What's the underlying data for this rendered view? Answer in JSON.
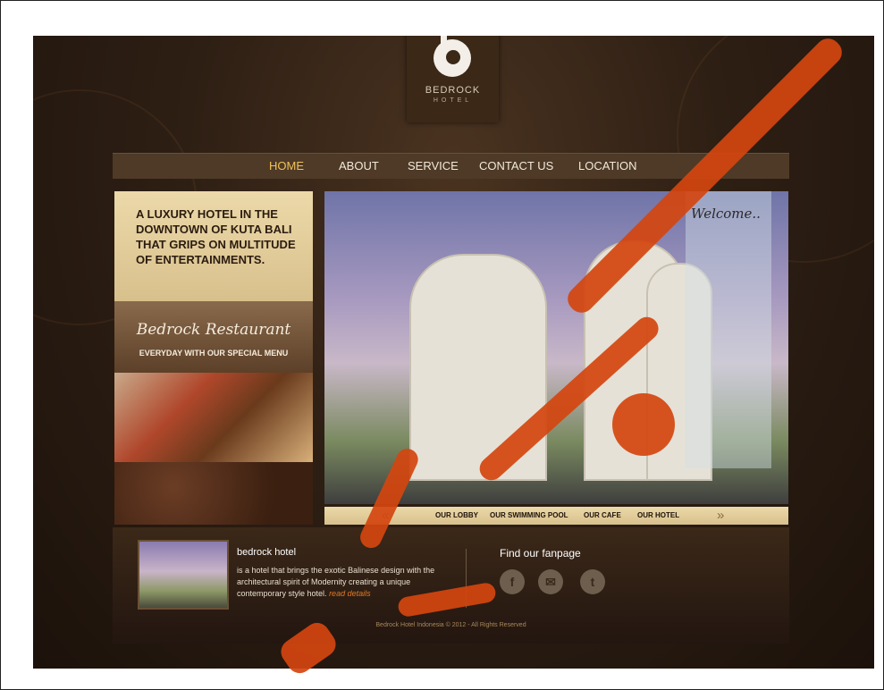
{
  "logo": {
    "name": "BEDROCK",
    "sub": "HOTEL"
  },
  "nav": {
    "items": [
      {
        "label": "HOME",
        "active": true
      },
      {
        "label": "ABOUT",
        "active": false
      },
      {
        "label": "SERVICE",
        "active": false
      },
      {
        "label": "CONTACT US",
        "active": false
      },
      {
        "label": "LOCATION",
        "active": false
      }
    ]
  },
  "tagline": "A LUXURY HOTEL IN THE DOWNTOWN OF KUTA BALI THAT GRIPS ON MULTITUDE OF ENTERTAINMENTS.",
  "restaurant": {
    "title": "Bedrock Restaurant",
    "subtitle": "EVERYDAY WITH OUR SPECIAL MENU"
  },
  "slider": {
    "welcome": "Welcome..",
    "prev": "«",
    "next": "»",
    "links": [
      "OUR LOBBY",
      "OUR SWIMMING POOL",
      "OUR CAFE",
      "OUR HOTEL"
    ]
  },
  "info": {
    "title": "bedrock hotel",
    "description": "is a hotel that brings the exotic Balinese design with the architectural spirit of Modernity creating a unique contemporary style hotel.",
    "read_more": "read details",
    "fanpage_title": "Find our fanpage",
    "social": [
      {
        "icon": "facebook-icon",
        "glyph": "f"
      },
      {
        "icon": "email-icon",
        "glyph": "✉"
      },
      {
        "icon": "twitter-icon",
        "glyph": "t"
      }
    ],
    "copyright": "Bedrock Hotel Indonesia © 2012 - All Rights Reserved"
  },
  "colors": {
    "accent": "#f0c25a",
    "link": "#e07a28",
    "watermark": "#d4450f"
  }
}
